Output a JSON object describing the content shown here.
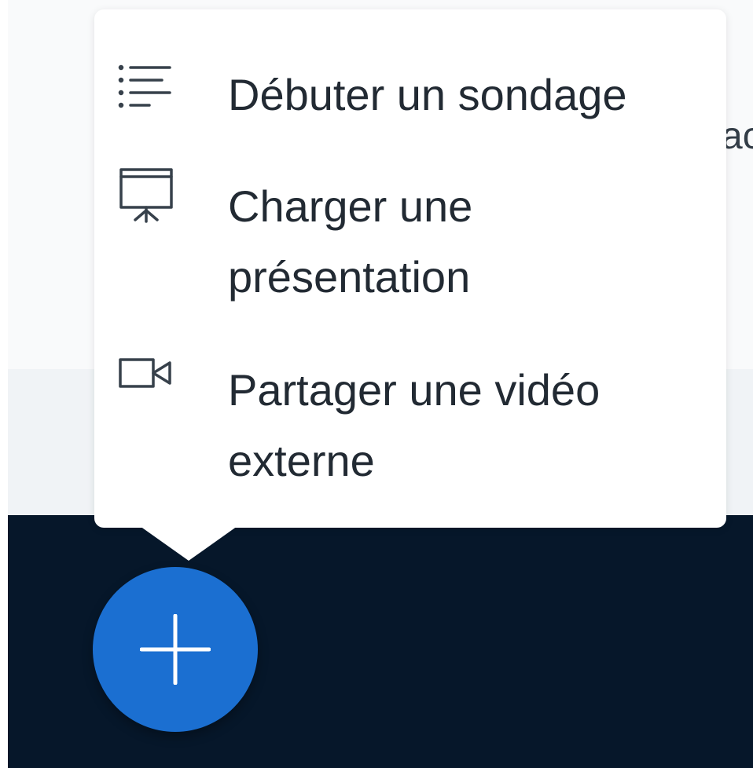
{
  "actions_menu": {
    "items": [
      {
        "label": "Débuter un sondage",
        "icon": "poll-icon"
      },
      {
        "label": "Charger une présentation",
        "icon": "presentation-icon"
      },
      {
        "label": "Partager une vidéo externe",
        "icon": "video-icon"
      }
    ]
  },
  "fab": {
    "icon": "plus-icon"
  },
  "colors": {
    "fab": "#1b6fd1",
    "dark_bar": "#06172a",
    "menu_bg": "#ffffff",
    "text": "#222a33",
    "icon": "#37414b"
  }
}
